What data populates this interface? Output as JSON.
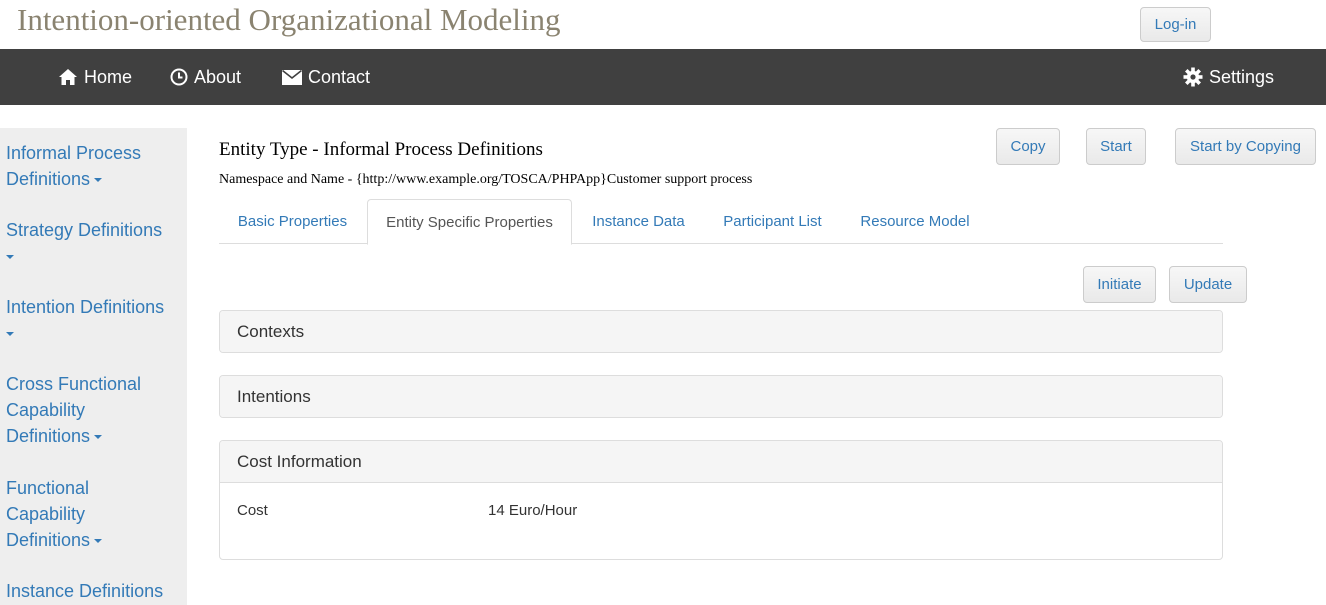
{
  "app": {
    "title": "Intention-oriented Organizational Modeling",
    "login_label": "Log-in"
  },
  "nav": {
    "home": {
      "label": "Home",
      "icon": "home-icon"
    },
    "about": {
      "label": "About",
      "icon": "clock-icon"
    },
    "contact": {
      "label": "Contact",
      "icon": "envelope-icon"
    },
    "settings": {
      "label": "Settings",
      "icon": "gear-icon"
    }
  },
  "sidebar": {
    "items": [
      {
        "label": "Informal Process Definitions",
        "has_caret": true
      },
      {
        "label": "Strategy Definitions",
        "has_caret": true
      },
      {
        "label": "Intention Definitions",
        "has_caret": true
      },
      {
        "label": "Cross Functional Capability Definitions",
        "has_caret": true
      },
      {
        "label": "Functional Capability Definitions",
        "has_caret": true
      },
      {
        "label": "Instance Definitions",
        "has_caret": false
      }
    ]
  },
  "main": {
    "entity_title": "Entity Type - Informal Process Definitions",
    "namespace_line": "Namespace and Name - {http://www.example.org/TOSCA/PHPApp}Customer support process",
    "actions": {
      "copy": "Copy",
      "start": "Start",
      "start_by_copying": "Start by Copying"
    },
    "tabs": [
      {
        "label": "Basic Properties",
        "active": false
      },
      {
        "label": "Entity Specific Properties",
        "active": true
      },
      {
        "label": "Instance Data",
        "active": false
      },
      {
        "label": "Participant List",
        "active": false
      },
      {
        "label": "Resource Model",
        "active": false
      }
    ],
    "tab_actions": {
      "initiate": "Initiate",
      "update": "Update"
    },
    "panels": {
      "contexts": "Contexts",
      "intentions": "Intentions",
      "cost_information": "Cost Information"
    },
    "cost": {
      "label": "Cost",
      "value": "14 Euro/Hour"
    }
  },
  "colors": {
    "navbar": "#404040",
    "link": "#337ab7",
    "title": "#8a8370",
    "sidebar_bg": "#eeeeee"
  }
}
